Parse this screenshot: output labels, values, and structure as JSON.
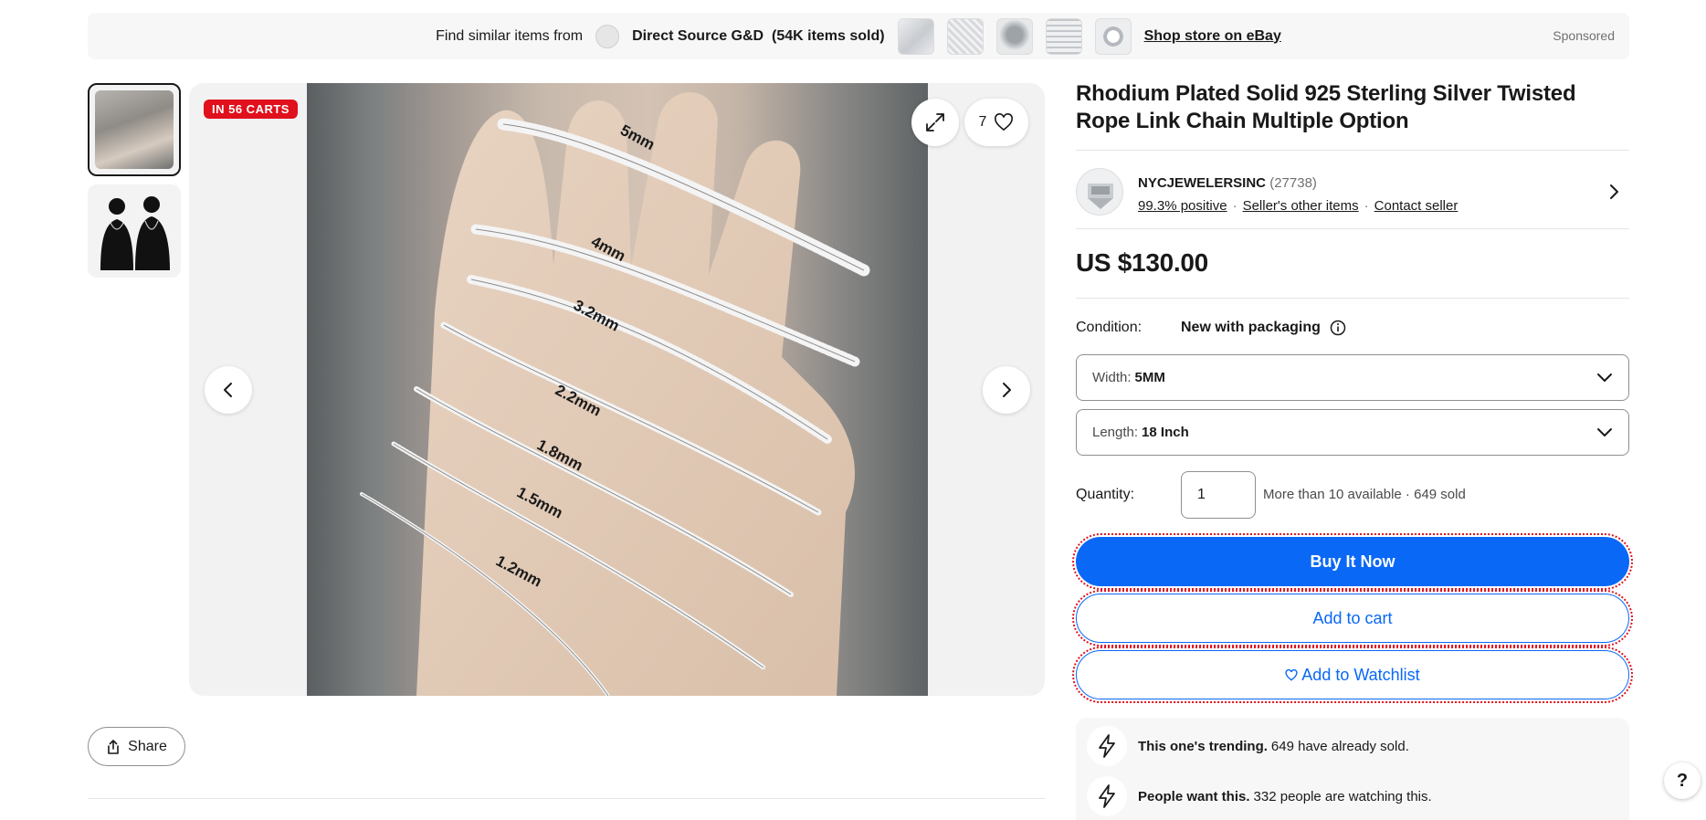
{
  "banner": {
    "find_text": "Find similar items from",
    "store_name": "Direct Source G&D",
    "store_sold": "(54K items sold)",
    "shop_link": "Shop store on eBay",
    "sponsored": "Sponsored"
  },
  "gallery": {
    "cart_badge": "IN 56 CARTS",
    "watch_count": "7",
    "image_labels": [
      "5mm",
      "4mm",
      "3.2mm",
      "2.2mm",
      "1.8mm",
      "1.5mm",
      "1.2mm"
    ],
    "share_label": "Share"
  },
  "listing": {
    "title": "Rhodium Plated Solid 925 Sterling Silver Twisted Rope Link Chain Multiple Option",
    "seller": {
      "name": "NYCJEWELERSINC",
      "feedback_count": "(27738)",
      "positive": "99.3% positive",
      "other_items": "Seller's other items",
      "contact": "Contact seller"
    },
    "price": "US $130.00",
    "condition_label": "Condition:",
    "condition_value": "New with packaging",
    "width": {
      "label": "Width:",
      "value": "5MM"
    },
    "length": {
      "label": "Length:",
      "value": "18 Inch"
    },
    "quantity": {
      "label": "Quantity:",
      "value": "1",
      "availability": "More than 10 available · 649 sold"
    },
    "buttons": {
      "buy_now": "Buy It Now",
      "add_to_cart": "Add to cart",
      "add_to_watchlist": "Add to Watchlist"
    },
    "signals": [
      {
        "bold": "This one's trending.",
        "text": "649 have already sold."
      },
      {
        "bold": "People want this.",
        "text": "332 people are watching this."
      }
    ]
  },
  "help": {
    "label": "?"
  },
  "colors": {
    "primary": "#0968f6",
    "badge": "#e0101c",
    "text": "#191919"
  }
}
